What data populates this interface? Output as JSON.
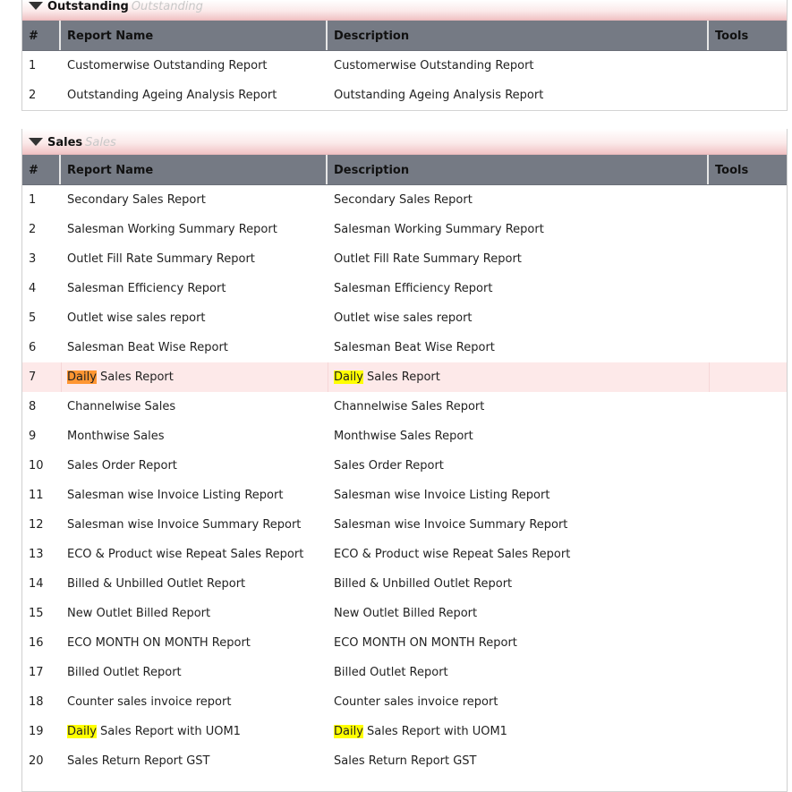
{
  "outstanding": {
    "title": "Outstanding",
    "subtitle": "Outstanding",
    "columns": [
      "#",
      "Report Name",
      "Description",
      "Tools"
    ],
    "rows": [
      {
        "num": "1",
        "name": "Customerwise Outstanding Report",
        "desc": "Customerwise Outstanding Report"
      },
      {
        "num": "2",
        "name": "Outstanding Ageing Analysis Report",
        "desc": "Outstanding Ageing Analysis Report"
      }
    ]
  },
  "sales": {
    "title": "Sales",
    "subtitle": "Sales",
    "columns": [
      "#",
      "Report Name",
      "Description",
      "Tools"
    ],
    "highlight_word": "Daily",
    "rows": [
      {
        "num": "1",
        "name": "Secondary Sales Report",
        "desc": "Secondary Sales Report"
      },
      {
        "num": "2",
        "name": "Salesman Working Summary Report",
        "desc": "Salesman Working Summary Report"
      },
      {
        "num": "3",
        "name": "Outlet Fill Rate Summary Report",
        "desc": "Outlet Fill Rate Summary Report"
      },
      {
        "num": "4",
        "name": "Salesman Efficiency Report",
        "desc": "Salesman Efficiency Report"
      },
      {
        "num": "5",
        "name": "Outlet wise sales report",
        "desc": "Outlet wise sales report"
      },
      {
        "num": "6",
        "name": "Salesman Beat Wise Report",
        "desc": "Salesman Beat Wise Report"
      },
      {
        "num": "7",
        "name": "Daily Sales Report",
        "desc": "Daily Sales Report",
        "hover": true,
        "mark": true,
        "current": true
      },
      {
        "num": "8",
        "name": "Channelwise Sales",
        "desc": "Channelwise Sales Report"
      },
      {
        "num": "9",
        "name": "Monthwise Sales",
        "desc": "Monthwise Sales Report"
      },
      {
        "num": "10",
        "name": "Sales Order Report",
        "desc": "Sales Order Report"
      },
      {
        "num": "11",
        "name": "Salesman wise Invoice Listing Report",
        "desc": "Salesman wise Invoice Listing Report"
      },
      {
        "num": "12",
        "name": "Salesman wise Invoice Summary Report",
        "desc": "Salesman wise Invoice Summary Report"
      },
      {
        "num": "13",
        "name": "ECO & Product wise Repeat Sales Report",
        "desc": "ECO & Product wise Repeat Sales Report"
      },
      {
        "num": "14",
        "name": "Billed & Unbilled Outlet Report",
        "desc": "Billed & Unbilled Outlet Report"
      },
      {
        "num": "15",
        "name": "New Outlet Billed Report",
        "desc": "New Outlet Billed Report"
      },
      {
        "num": "16",
        "name": "ECO MONTH ON MONTH Report",
        "desc": "ECO MONTH ON MONTH Report"
      },
      {
        "num": "17",
        "name": "Billed Outlet Report",
        "desc": "Billed Outlet Report"
      },
      {
        "num": "18",
        "name": "Counter sales invoice report",
        "desc": "Counter sales invoice report"
      },
      {
        "num": "19",
        "name": "Daily Sales Report with UOM1",
        "desc": "Daily Sales Report with UOM1",
        "mark": true
      },
      {
        "num": "20",
        "name": "Sales Return Report GST",
        "desc": "Sales Return Report GST"
      }
    ]
  },
  "colors": {
    "header_bg": "#757a84",
    "hover_row": "#fde9e9",
    "search_mark": "#ffff00",
    "search_current": "#ff9632"
  }
}
